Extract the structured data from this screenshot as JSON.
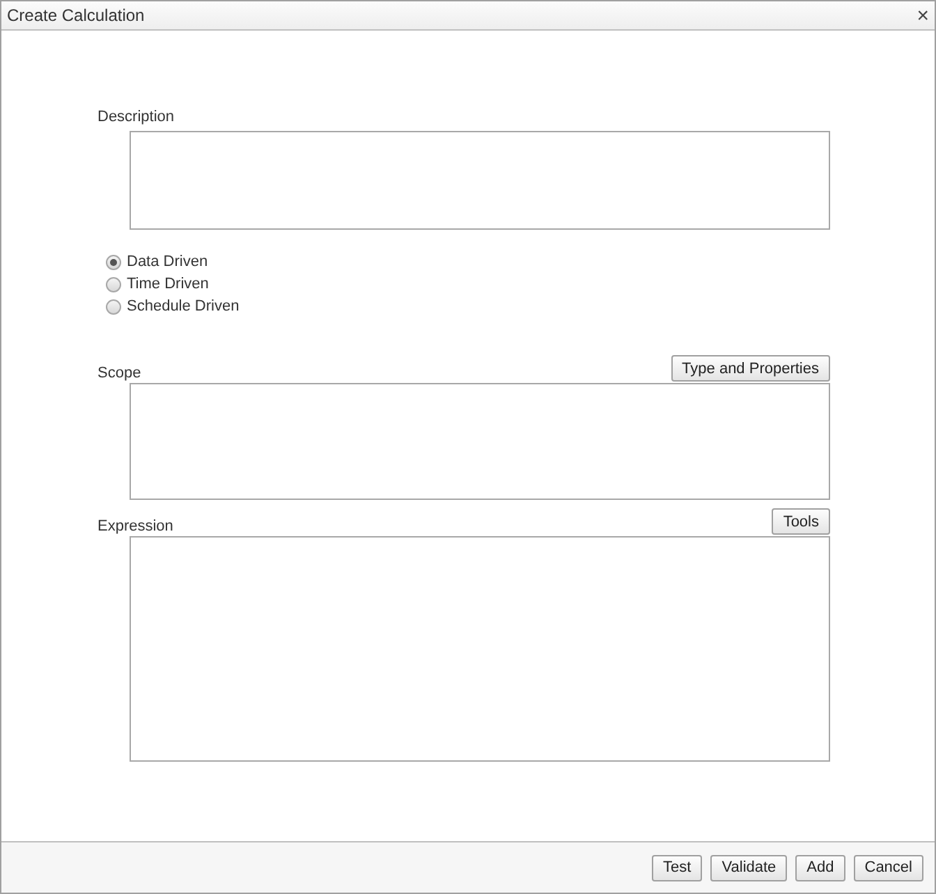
{
  "window": {
    "title": "Create Calculation",
    "close": "×"
  },
  "description": {
    "label": "Description"
  },
  "trigger": [
    {
      "label": "Data Driven",
      "selected": true
    },
    {
      "label": "Time Driven",
      "selected": false
    },
    {
      "label": "Schedule Driven",
      "selected": false
    }
  ],
  "scope": {
    "label": "Scope",
    "button": "Type and Properties"
  },
  "expression": {
    "label": "Expression",
    "button": "Tools"
  },
  "buttons": [
    "Test",
    "Validate",
    "Add",
    "Cancel"
  ]
}
